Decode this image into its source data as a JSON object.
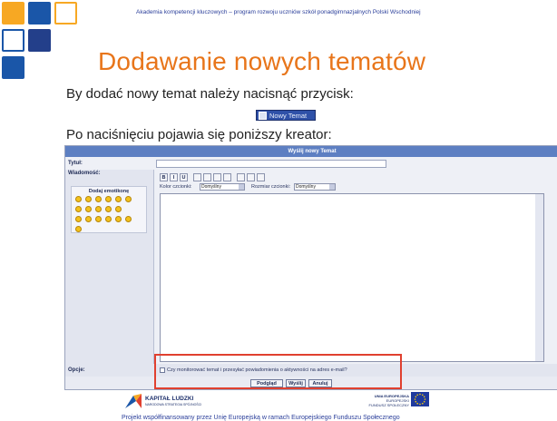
{
  "header": {
    "text": "Akademia kompetencji kluczowych – program rozwoju uczniów szkół ponadgimnazjalnych Polski Wschodniej"
  },
  "slide": {
    "title": "Dodawanie nowych tematów",
    "line1": "By dodać nowy temat należy nacisnąć przycisk:",
    "new_topic_button": "Nowy Temat",
    "line2": "Po naciśnięciu pojawia się poniższy kreator:"
  },
  "form": {
    "header": "Wyślij nowy Temat",
    "title_label": "Tytuł:",
    "message_label": "Wiadomość:",
    "emoticons_title": "Dodaj emotikonę",
    "font_color_label": "Kolor czcionki:",
    "font_color_value": "Domyślny",
    "font_size_label": "Rozmiar czcionki:",
    "font_size_value": "Domyślny",
    "options_label": "Opcje:",
    "notify_option": "Czy monitorować temat i przesyłać powiadomienia o aktywności na adres e-mail?",
    "buttons": {
      "preview": "Podgląd",
      "send": "Wyślij",
      "cancel": "Anuluj"
    }
  },
  "footer": {
    "kl_name": "KAPITAŁ LUDZKI",
    "kl_sub": "NARODOWA STRATEGIA SPÓJNOŚCI",
    "ue_line1": "UNIA EUROPEJSKA",
    "ue_line2": "EUROPEJSKI",
    "ue_line3": "FUNDUSZ SPOŁECZNY",
    "text": "Projekt współfinansowany przez Unię Europejską w ramach Europejskiego Funduszu Społecznego"
  },
  "colors": {
    "title": "#e8751a",
    "square_orange": "#f7a823",
    "square_blue": "#1a56a8",
    "square_navy": "#233f8a",
    "highlight": "#e0402f",
    "header_text": "#2a3e9a"
  }
}
